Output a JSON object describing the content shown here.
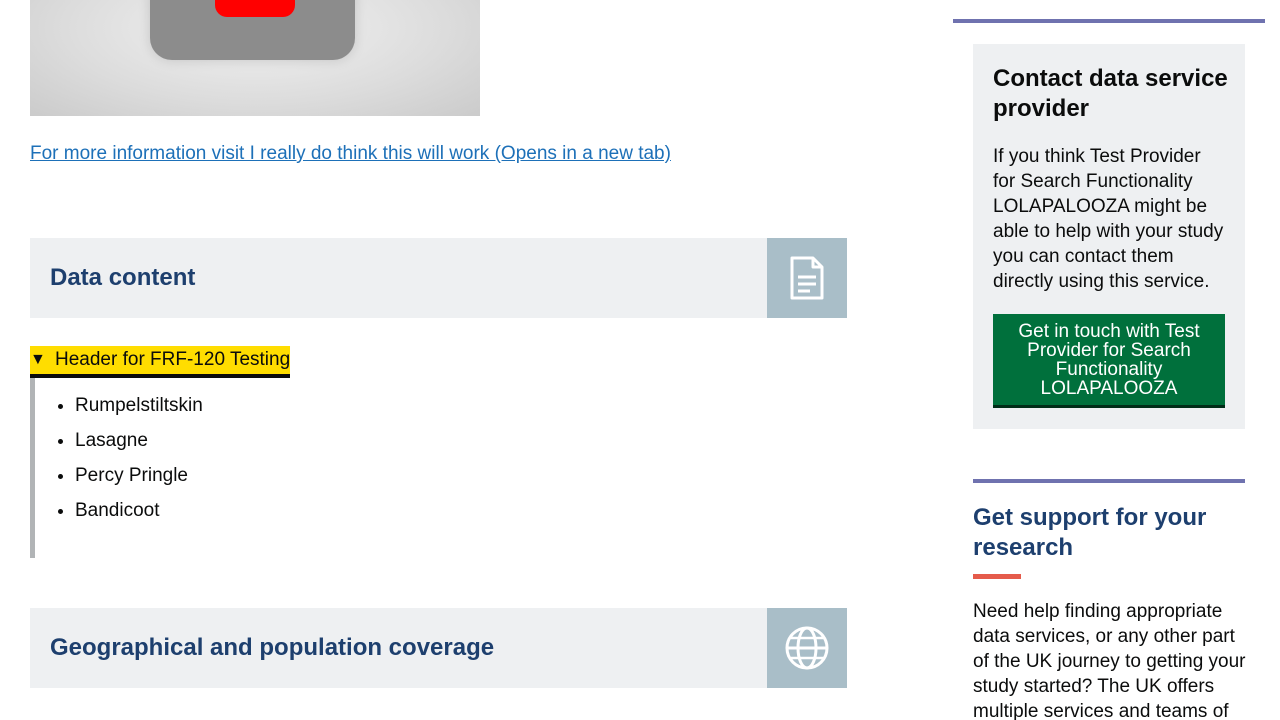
{
  "video": {
    "thumbnail_icon": "youtube-play-icon"
  },
  "more_info_link": "For more information visit I really do think this will work (Opens in a new tab)",
  "data_content": {
    "title": "Data content",
    "icon": "document-icon"
  },
  "details": {
    "arrow": "▼",
    "summary": "Header for FRF-120 Testing",
    "items": [
      "Rumpelstiltskin",
      "Lasagne",
      "Percy Pringle",
      "Bandicoot"
    ]
  },
  "geo": {
    "title": "Geographical and population coverage",
    "icon": "globe-icon"
  },
  "contact": {
    "heading": "Contact data service provider",
    "description": "If you think Test Provider for Search Functionality LOLAPALOOZA might be able to help with your study you can contact them directly using this service.",
    "button_label": "Get in touch with Test Provider for Search Functionality LOLAPALOOZA"
  },
  "support": {
    "heading": "Get support for your research",
    "text": "Need help finding appropriate data services, or any other part of the UK journey to getting your study started? The UK offers multiple services and teams of"
  },
  "colors": {
    "link": "#1d70b8",
    "heading_blue": "#1d3f6e",
    "button_green": "#00703c",
    "focus_yellow": "#ffdd00",
    "accent_purple": "#6f72af",
    "accent_red": "#e55b4b"
  }
}
